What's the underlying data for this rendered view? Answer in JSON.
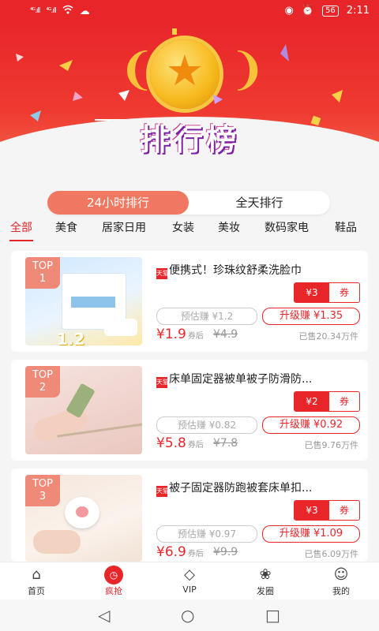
{
  "status_bar": {
    "signal1": "⁴ᴳ.ıll",
    "signal2": "⁴ᴳ.ıll",
    "wifi": "wifi-icon",
    "battery": "56",
    "time": "2:11"
  },
  "hero": {
    "title": "排行榜"
  },
  "tabs": [
    {
      "label": "24小时排行"
    },
    {
      "label": "全天排行"
    }
  ],
  "categories": [
    {
      "label": "全部"
    },
    {
      "label": "美食"
    },
    {
      "label": "居家日用"
    },
    {
      "label": "女装"
    },
    {
      "label": "美妆"
    },
    {
      "label": "数码家电"
    },
    {
      "label": "鞋品"
    }
  ],
  "products": [
    {
      "rank_label": "TOP",
      "rank": "1",
      "title": "便携式！珍珠纹舒柔洗脸巾",
      "coupon_amount": "¥3",
      "coupon_label": "券",
      "estimate": "预估赚 ¥1.2",
      "upgrade": "升级赚 ¥1.35",
      "price": "¥1.9",
      "price_suffix": "券后",
      "original": "¥4.9",
      "sold": "已售20.34万件"
    },
    {
      "rank_label": "TOP",
      "rank": "2",
      "title": "床单固定器被单被子防滑防...",
      "coupon_amount": "¥2",
      "coupon_label": "券",
      "estimate": "预估赚 ¥0.82",
      "upgrade": "升级赚 ¥0.92",
      "price": "¥5.8",
      "price_suffix": "券后",
      "original": "¥7.8",
      "sold": "已售9.76万件"
    },
    {
      "rank_label": "TOP",
      "rank": "3",
      "title": "被子固定器防跑被套床单扣...",
      "coupon_amount": "¥3",
      "coupon_label": "券",
      "estimate": "预估赚 ¥0.97",
      "upgrade": "升级赚 ¥1.09",
      "price": "¥6.9",
      "price_suffix": "券后",
      "original": "¥9.9",
      "sold": "已售6.09万件"
    }
  ],
  "bottom_nav": [
    {
      "label": "首页",
      "icon": "home-icon"
    },
    {
      "label": "疯抢",
      "icon": "clock-icon"
    },
    {
      "label": "VIP",
      "icon": "diamond-icon"
    },
    {
      "label": "发圈",
      "icon": "lotus-icon"
    },
    {
      "label": "我的",
      "icon": "user-icon"
    }
  ],
  "colors": {
    "accent": "#e8262a",
    "tab_active": "#f07760"
  }
}
